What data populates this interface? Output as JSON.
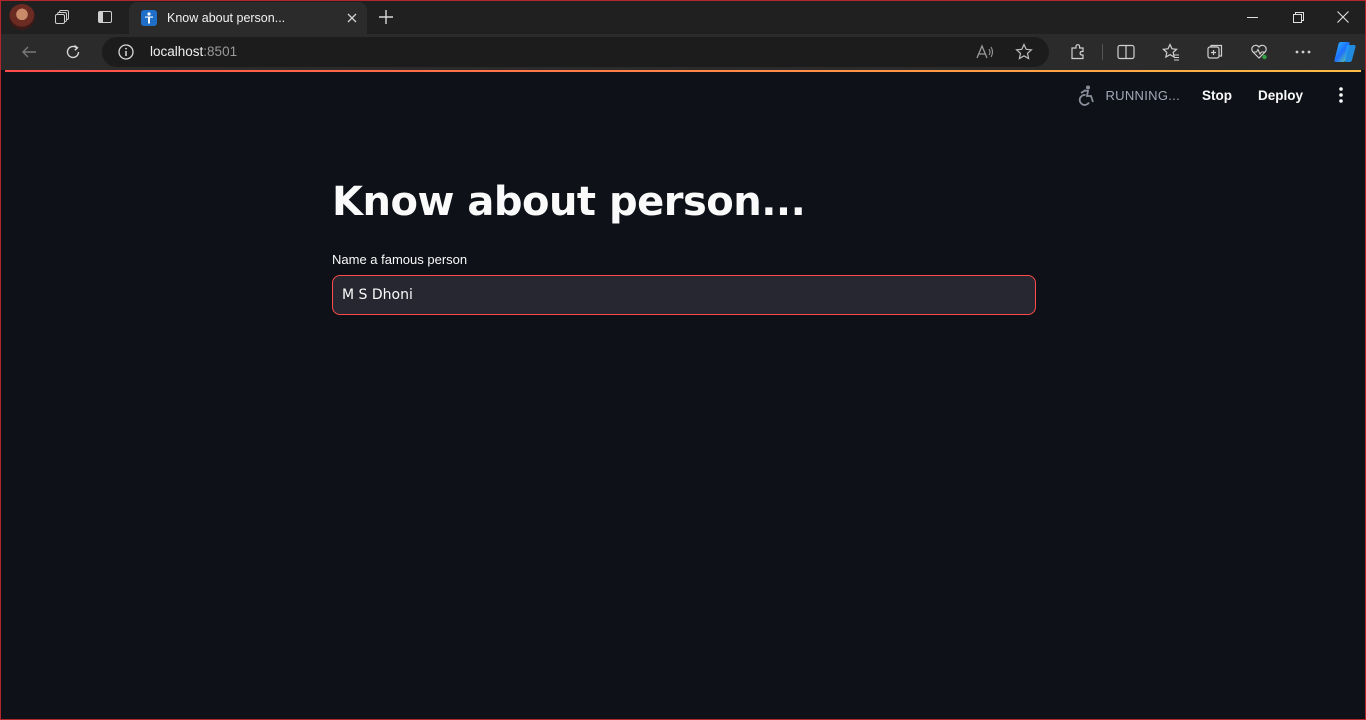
{
  "browser": {
    "tab_title": "Know about person...",
    "url_host": "localhost",
    "url_port": ":8501"
  },
  "app": {
    "status": "RUNNING...",
    "stop_label": "Stop",
    "deploy_label": "Deploy",
    "title": "Know about person...",
    "field_label": "Name a famous person",
    "field_value": "M S Dhoni"
  },
  "colors": {
    "accent": "#ff4b4b",
    "app_bg": "#0e1117",
    "input_bg": "#262730",
    "window_border": "#b3262b"
  }
}
